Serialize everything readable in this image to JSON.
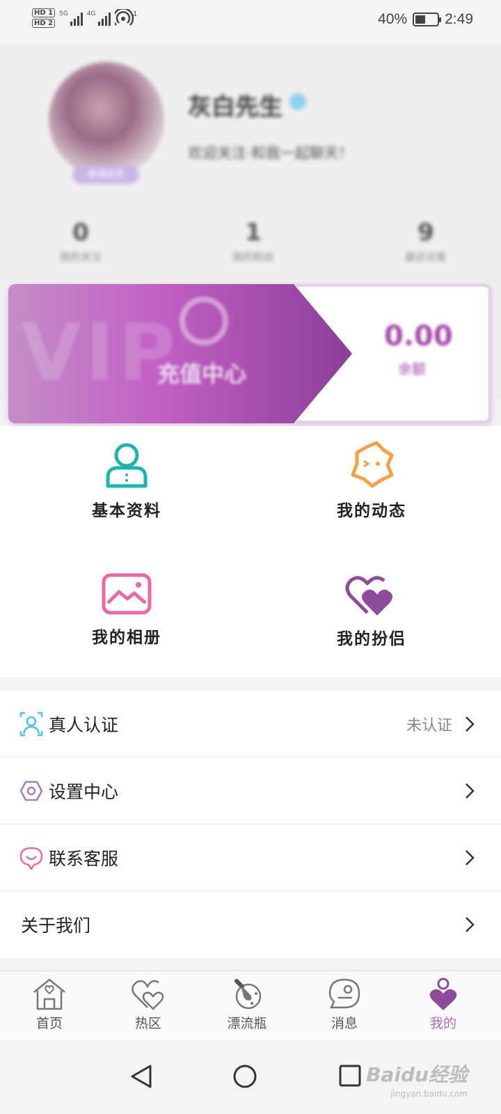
{
  "status_bar": {
    "hd1": "HD 1",
    "hd2": "HD 2",
    "net1": "5G",
    "net2": "4G",
    "hotspot_count": "1",
    "battery": "40%",
    "time": "2:49"
  },
  "profile": {
    "nickname": "灰白先生",
    "bio": "欢迎关注·和我一起聊天！",
    "avatar_badge": "普通会员",
    "stats": [
      {
        "num": "0",
        "label": "我的关注"
      },
      {
        "num": "1",
        "label": "我的粉丝"
      },
      {
        "num": "9",
        "label": "最近访客"
      }
    ]
  },
  "vip": {
    "watermark": "VIP",
    "title": "充值中心",
    "balance": "0.00",
    "balance_label": "余额"
  },
  "features": [
    {
      "label": "基本资料",
      "icon": "user-profile-icon",
      "color": "#1fb3ad"
    },
    {
      "label": "我的动态",
      "icon": "dynamic-face-icon",
      "color": "#f0a24a"
    },
    {
      "label": "我的相册",
      "icon": "album-icon",
      "color": "#e86aa5"
    },
    {
      "label": "我的扮侣",
      "icon": "couple-heart-icon",
      "color": "#8e4b9c"
    }
  ],
  "menu": [
    {
      "label": "真人认证",
      "value": "未认证",
      "icon": "face-verify-icon"
    },
    {
      "label": "设置中心",
      "value": "",
      "icon": "settings-hexagon-icon"
    },
    {
      "label": "联系客服",
      "value": "",
      "icon": "customer-service-icon"
    },
    {
      "label": "关于我们",
      "value": "",
      "icon": ""
    }
  ],
  "tabs": [
    {
      "label": "首页",
      "icon": "home-icon"
    },
    {
      "label": "热区",
      "icon": "hot-heart-icon"
    },
    {
      "label": "漂流瓶",
      "icon": "drift-bottle-icon"
    },
    {
      "label": "消息",
      "icon": "message-icon"
    },
    {
      "label": "我的",
      "icon": "me-icon",
      "active": true
    }
  ],
  "colors": {
    "accent": "#b06bb8",
    "vip_start": "#c48dc9",
    "vip_end": "#8b3f96"
  },
  "watermark": {
    "brand": "Baidu经验",
    "url": "jingyan.baidu.com"
  }
}
